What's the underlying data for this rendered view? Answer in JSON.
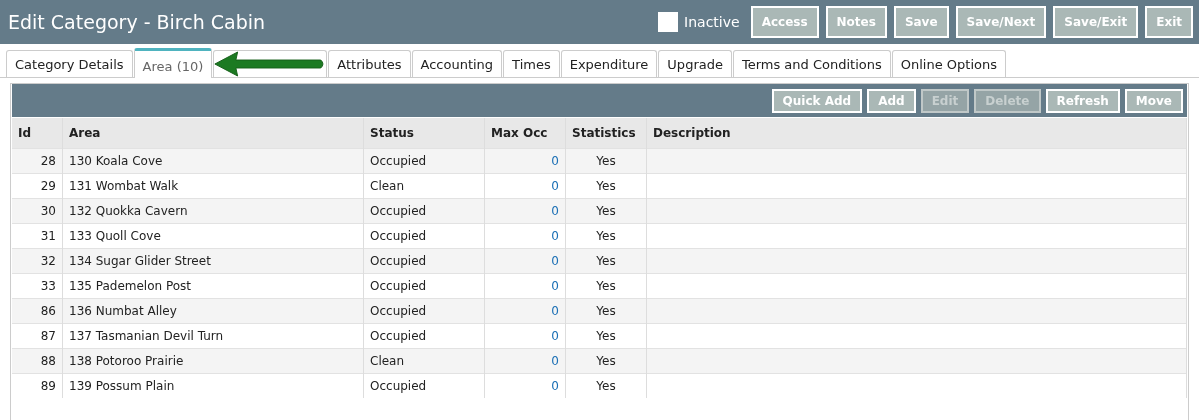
{
  "window": {
    "title": "Edit Category - Birch Cabin"
  },
  "inactive": {
    "label": "Inactive",
    "checked": false
  },
  "header_buttons": [
    "Access",
    "Notes",
    "Save",
    "Save/Next",
    "Save/Exit",
    "Exit"
  ],
  "tabs": [
    {
      "label": "Category Details",
      "selected": false
    },
    {
      "label": "Area (10)",
      "selected": true
    },
    {
      "selected": false
    },
    {
      "label": "Attributes",
      "selected": false
    },
    {
      "label": "Accounting",
      "selected": false
    },
    {
      "label": "Times",
      "selected": false
    },
    {
      "label": "Expenditure",
      "selected": false
    },
    {
      "label": "Upgrade",
      "selected": false
    },
    {
      "label": "Terms and Conditions",
      "selected": false
    },
    {
      "label": "Online Options",
      "selected": false
    }
  ],
  "toolbar": [
    {
      "label": "Quick Add",
      "disabled": false
    },
    {
      "label": "Add",
      "disabled": false
    },
    {
      "label": "Edit",
      "disabled": true
    },
    {
      "label": "Delete",
      "disabled": true
    },
    {
      "label": "Refresh",
      "disabled": false
    },
    {
      "label": "Move",
      "disabled": false
    }
  ],
  "table": {
    "columns": [
      "Id",
      "Area",
      "Status",
      "Max Occ",
      "Statistics",
      "Description"
    ],
    "rows": [
      [
        "28",
        "130 Koala Cove",
        "Occupied",
        "0",
        "Yes"
      ],
      [
        "29",
        "131 Wombat Walk",
        "Clean",
        "0",
        "Yes"
      ],
      [
        "30",
        "132 Quokka Cavern",
        "Occupied",
        "0",
        "Yes"
      ],
      [
        "31",
        "133 Quoll Cove",
        "Occupied",
        "0",
        "Yes"
      ],
      [
        "32",
        "134 Sugar Glider Street",
        "Occupied",
        "0",
        "Yes"
      ],
      [
        "33",
        "135 Pademelon Post",
        "Occupied",
        "0",
        "Yes"
      ],
      [
        "86",
        "136 Numbat Alley",
        "Occupied",
        "0",
        "Yes"
      ],
      [
        "87",
        "137 Tasmanian Devil Turn",
        "Occupied",
        "0",
        "Yes"
      ],
      [
        "88",
        "138 Potoroo Prairie",
        "Clean",
        "0",
        "Yes"
      ],
      [
        "89",
        "139 Possum Plain",
        "Occupied",
        "0",
        "Yes"
      ]
    ]
  }
}
